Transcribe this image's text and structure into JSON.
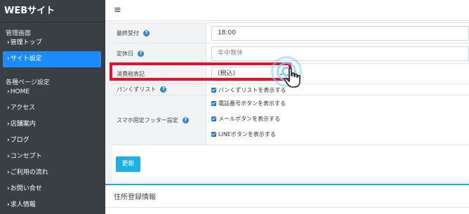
{
  "sidebar": {
    "brand": "WEBサイト",
    "section1": "管理画面",
    "items1": [
      {
        "label": "管理トップ",
        "active": false
      },
      {
        "label": "サイト設定",
        "active": true
      }
    ],
    "section2": "各種ページ設定",
    "items2": [
      {
        "label": "HOME"
      },
      {
        "label": "アクセス"
      },
      {
        "label": "店舗案内"
      },
      {
        "label": "ブログ"
      },
      {
        "label": "コンセプト"
      },
      {
        "label": "ご利用の流れ"
      },
      {
        "label": "お問い合せ"
      },
      {
        "label": "求人情報"
      }
    ],
    "chevron": "›"
  },
  "topbar": {
    "menu_icon": "≡"
  },
  "form": {
    "last_reception": {
      "label": "最終受付",
      "value": "18:00"
    },
    "closed_day": {
      "label": "定休日",
      "placeholder": "年中無休"
    },
    "tax_display": {
      "label": "消費税表記",
      "value": "(税込)",
      "arrow": "⌄"
    },
    "breadcrumb": {
      "label": "パンくずリスト",
      "checkbox": "パンくずリストを表示する"
    },
    "footer_fixed": {
      "label": "スマホ固定フッター設定",
      "checkboxes": [
        "電話番号ボタンを表示する",
        "メールボタンを表示する",
        "LINEボタンを表示する"
      ]
    },
    "help_glyph": "?"
  },
  "update_button": "更新",
  "address_section": {
    "title": "住所登録情報"
  },
  "colors": {
    "accent": "#1a8cff",
    "highlight": "#e8102a",
    "button": "#1ab0e8"
  }
}
